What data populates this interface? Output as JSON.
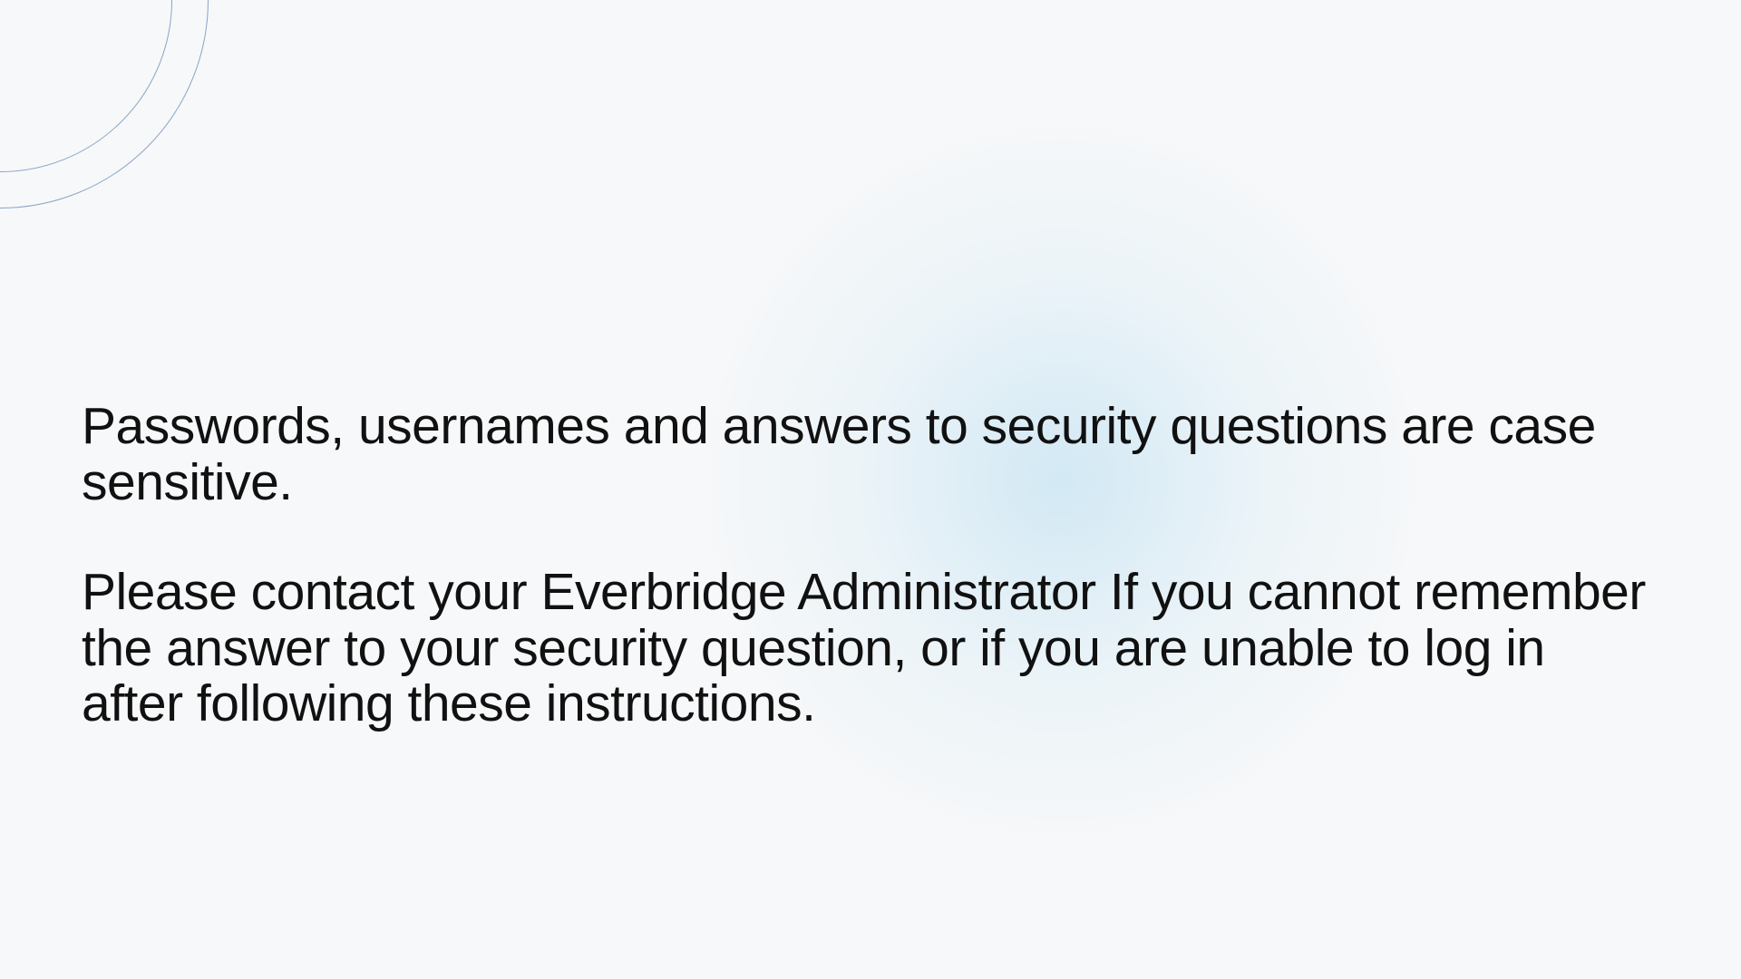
{
  "content": {
    "paragraph1": "Passwords, usernames and answers to security questions are case sensitive.",
    "paragraph2": "Please contact your Everbridge Administrator If you cannot remember the answer to your security question, or if you are unable to log in after following these instructions."
  }
}
